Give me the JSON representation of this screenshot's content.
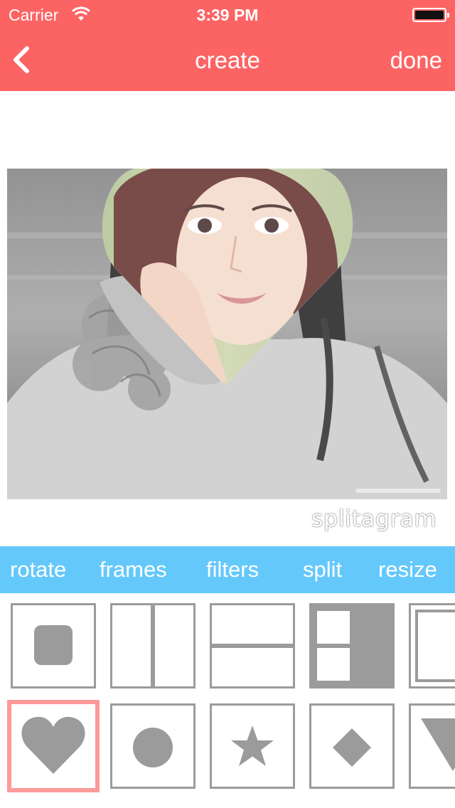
{
  "status_bar": {
    "carrier": "Carrier",
    "time": "3:39 PM"
  },
  "nav": {
    "title": "create",
    "done_label": "done",
    "back_icon": "chevron-left-icon"
  },
  "editor": {
    "watermark": "splitagram",
    "frame_shape": "heart"
  },
  "tabs": [
    {
      "label": "rotate"
    },
    {
      "label": "frames"
    },
    {
      "label": "filters"
    },
    {
      "label": "split"
    },
    {
      "label": "resize"
    }
  ],
  "layouts": {
    "row1": [
      "rounded-square",
      "two-columns",
      "two-rows",
      "left-grid-split",
      "partial-frame"
    ],
    "row2": [
      "heart",
      "circle",
      "star",
      "diamond",
      "triangle"
    ],
    "selected": "heart"
  },
  "colors": {
    "nav_bar": "#fc6464",
    "tab_bar": "#64c8fa",
    "selected_border": "#fc9a9a",
    "shape_gray": "#9b9b9b"
  }
}
